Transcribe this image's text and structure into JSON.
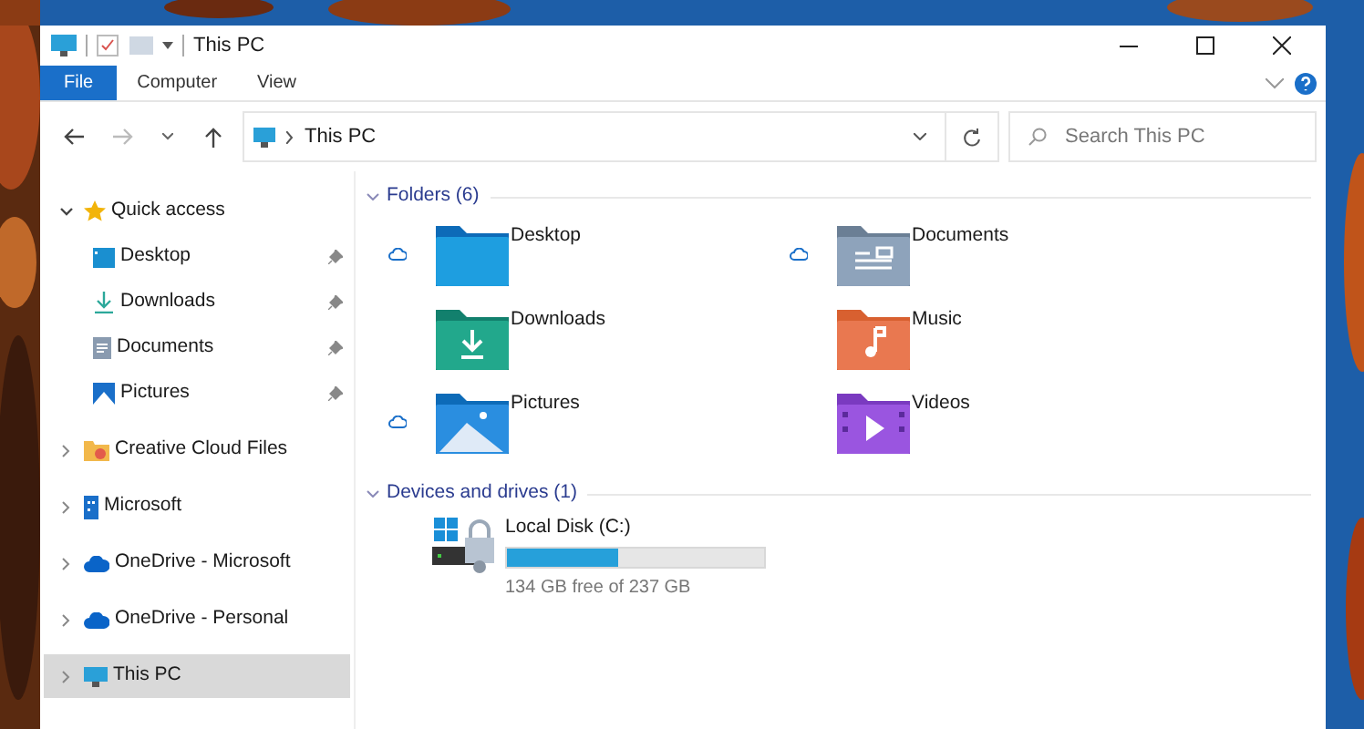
{
  "window": {
    "title": "This PC"
  },
  "ribbon_tabs": [
    {
      "label": "File",
      "selected": true
    },
    {
      "label": "Computer",
      "selected": false
    },
    {
      "label": "View",
      "selected": false
    }
  ],
  "address_bar": {
    "path": "This PC"
  },
  "search": {
    "placeholder": "Search This PC"
  },
  "nav_pane": [
    {
      "label": "Quick access",
      "kind": "star",
      "expanded": true,
      "selected": false,
      "children": [
        {
          "label": "Desktop",
          "kind": "desktop",
          "pinned": true,
          "selected": false
        },
        {
          "label": "Downloads",
          "kind": "downloads",
          "pinned": true,
          "selected": false
        },
        {
          "label": "Documents",
          "kind": "documents",
          "pinned": true,
          "selected": false
        },
        {
          "label": "Pictures",
          "kind": "pictures",
          "pinned": true,
          "selected": false
        }
      ]
    },
    {
      "label": "Creative Cloud Files",
      "kind": "creative",
      "expanded": false,
      "selected": false
    },
    {
      "label": "Microsoft",
      "kind": "building",
      "expanded": false,
      "selected": false
    },
    {
      "label": "OneDrive - Microsoft",
      "kind": "onedrive",
      "expanded": false,
      "selected": false
    },
    {
      "label": "OneDrive - Personal",
      "kind": "onedrive",
      "expanded": false,
      "selected": false
    },
    {
      "label": "This PC",
      "kind": "pc",
      "expanded": false,
      "selected": true
    }
  ],
  "folders": {
    "header": "Folders (6)",
    "expanded": true,
    "items": [
      {
        "name": "Desktop",
        "kind": "desktop",
        "cloud": true
      },
      {
        "name": "Documents",
        "kind": "documents",
        "cloud": true
      },
      {
        "name": "Downloads",
        "kind": "downloads",
        "cloud": false
      },
      {
        "name": "Music",
        "kind": "music",
        "cloud": false
      },
      {
        "name": "Pictures",
        "kind": "pictures",
        "cloud": true
      },
      {
        "name": "Videos",
        "kind": "videos",
        "cloud": false
      }
    ]
  },
  "drives": {
    "header": "Devices and drives (1)",
    "expanded": true,
    "items": [
      {
        "name": "Local Disk (C:)",
        "level": 0.43,
        "free": "134 GB free of 237 GB"
      }
    ]
  }
}
